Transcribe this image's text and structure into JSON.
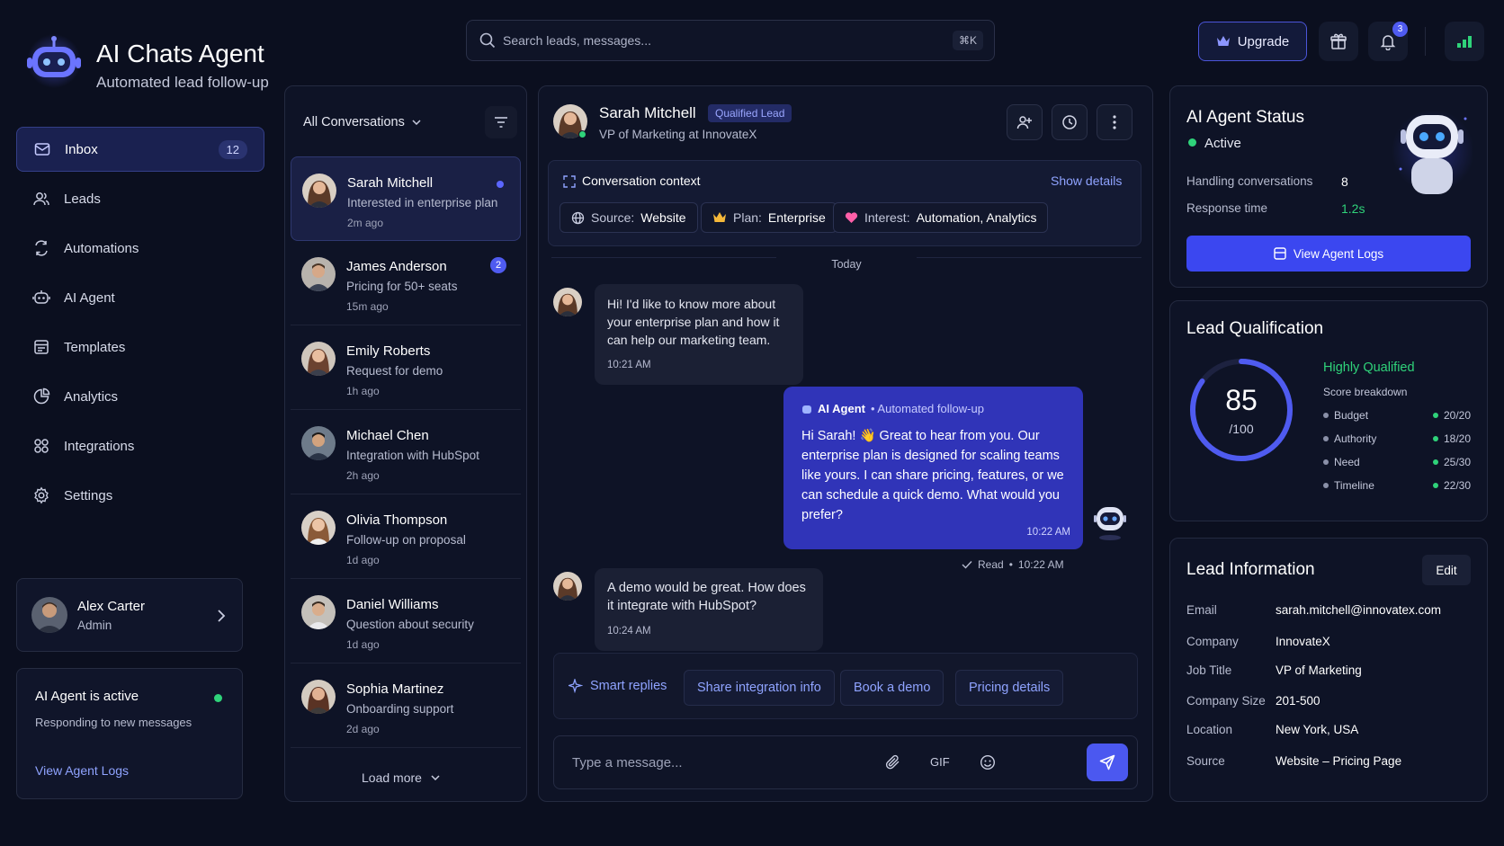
{
  "brand": {
    "title": "AI Chats Agent",
    "subtitle": "Automated lead follow-up"
  },
  "search": {
    "placeholder": "Search leads, messages...",
    "shortcut": "⌘K"
  },
  "topbar": {
    "upgrade_label": "Upgrade",
    "notification_count": "3"
  },
  "nav": {
    "items": [
      {
        "label": "Inbox",
        "badge": "12",
        "icon": "inbox-icon"
      },
      {
        "label": "Leads",
        "icon": "users-icon"
      },
      {
        "label": "Automations",
        "icon": "automation-icon"
      },
      {
        "label": "AI Agent",
        "icon": "robot-icon"
      },
      {
        "label": "Templates",
        "icon": "template-icon"
      },
      {
        "label": "Analytics",
        "icon": "analytics-icon"
      },
      {
        "label": "Integrations",
        "icon": "integrations-icon"
      },
      {
        "label": "Settings",
        "icon": "gear-icon"
      }
    ]
  },
  "profile": {
    "name": "Alex Carter",
    "role": "Admin"
  },
  "agent_card": {
    "title": "AI Agent is active",
    "subtitle": "Responding to new messages",
    "link": "View Agent Logs"
  },
  "conversations": {
    "filter_label": "All Conversations",
    "load_more": "Load more",
    "items": [
      {
        "name": "Sarah Mitchell",
        "preview": "Interested in enterprise plan",
        "time": "2m ago"
      },
      {
        "name": "James Anderson",
        "preview": "Pricing for 50+ seats",
        "time": "15m ago",
        "badge": "2"
      },
      {
        "name": "Emily Roberts",
        "preview": "Request for demo",
        "time": "1h ago"
      },
      {
        "name": "Michael Chen",
        "preview": "Integration with HubSpot",
        "time": "2h ago"
      },
      {
        "name": "Olivia Thompson",
        "preview": "Follow-up on proposal",
        "time": "1d ago"
      },
      {
        "name": "Daniel Williams",
        "preview": "Question about security",
        "time": "1d ago"
      },
      {
        "name": "Sophia Martinez",
        "preview": "Onboarding support",
        "time": "2d ago"
      }
    ]
  },
  "chat": {
    "contact_name": "Sarah Mitchell",
    "contact_badge": "Qualified Lead",
    "contact_title": "VP of Marketing at InnovateX",
    "context_title": "Conversation context",
    "show_details": "Show details",
    "source_label": "Source:",
    "source_value": "Website",
    "plan_label": "Plan:",
    "plan_value": "Enterprise",
    "interest_label": "Interest:",
    "interest_value": "Automation, Analytics",
    "day_divider": "Today",
    "messages": [
      {
        "text": "Hi! I'd like to know more about your enterprise plan and how it can help our marketing team.",
        "time": "10:21 AM"
      },
      {
        "sender": "AI Agent",
        "sender_note": "• Automated follow-up",
        "text": "Hi Sarah! 👋 Great to hear from you. Our enterprise plan is designed for scaling teams like yours. I can share pricing, features, or we can schedule a quick demo. What would you prefer?",
        "time": "10:22 AM",
        "read_status": "Read",
        "read_time": "10:22 AM"
      },
      {
        "text": "A demo would be great. How does it integrate with HubSpot?",
        "time": "10:24 AM"
      }
    ],
    "smart_replies_label": "Smart replies",
    "replies": [
      "Share integration info",
      "Book a demo",
      "Pricing details"
    ],
    "composer_placeholder": "Type a message...",
    "gif_label": "GIF"
  },
  "agent_status": {
    "title": "AI Agent Status",
    "status": "Active",
    "handling_label": "Handling conversations",
    "handling_value": "8",
    "response_label": "Response time",
    "response_value": "1.2s",
    "button": "View Agent Logs"
  },
  "qualification": {
    "title": "Lead Qualification",
    "score": "85",
    "score_max": "/100",
    "score_fraction": 0.85,
    "level": "Highly Qualified",
    "breakdown_title": "Score breakdown",
    "items": [
      {
        "label": "Budget",
        "value": "20/20"
      },
      {
        "label": "Authority",
        "value": "18/20"
      },
      {
        "label": "Need",
        "value": "25/30"
      },
      {
        "label": "Timeline",
        "value": "22/30"
      }
    ]
  },
  "lead_info": {
    "title": "Lead Information",
    "edit": "Edit",
    "rows": [
      {
        "label": "Email",
        "value": "sarah.mitchell@innovatex.com"
      },
      {
        "label": "Company",
        "value": "InnovateX"
      },
      {
        "label": "Job Title",
        "value": "VP of Marketing"
      },
      {
        "label": "Company Size",
        "value": "201-500"
      },
      {
        "label": "Location",
        "value": "New York, USA"
      },
      {
        "label": "Source",
        "value": "Website – Pricing Page"
      }
    ]
  },
  "colors": {
    "accent": "#4b58f0",
    "green": "#2fd37a",
    "ai_bubble": "#3034b8"
  }
}
